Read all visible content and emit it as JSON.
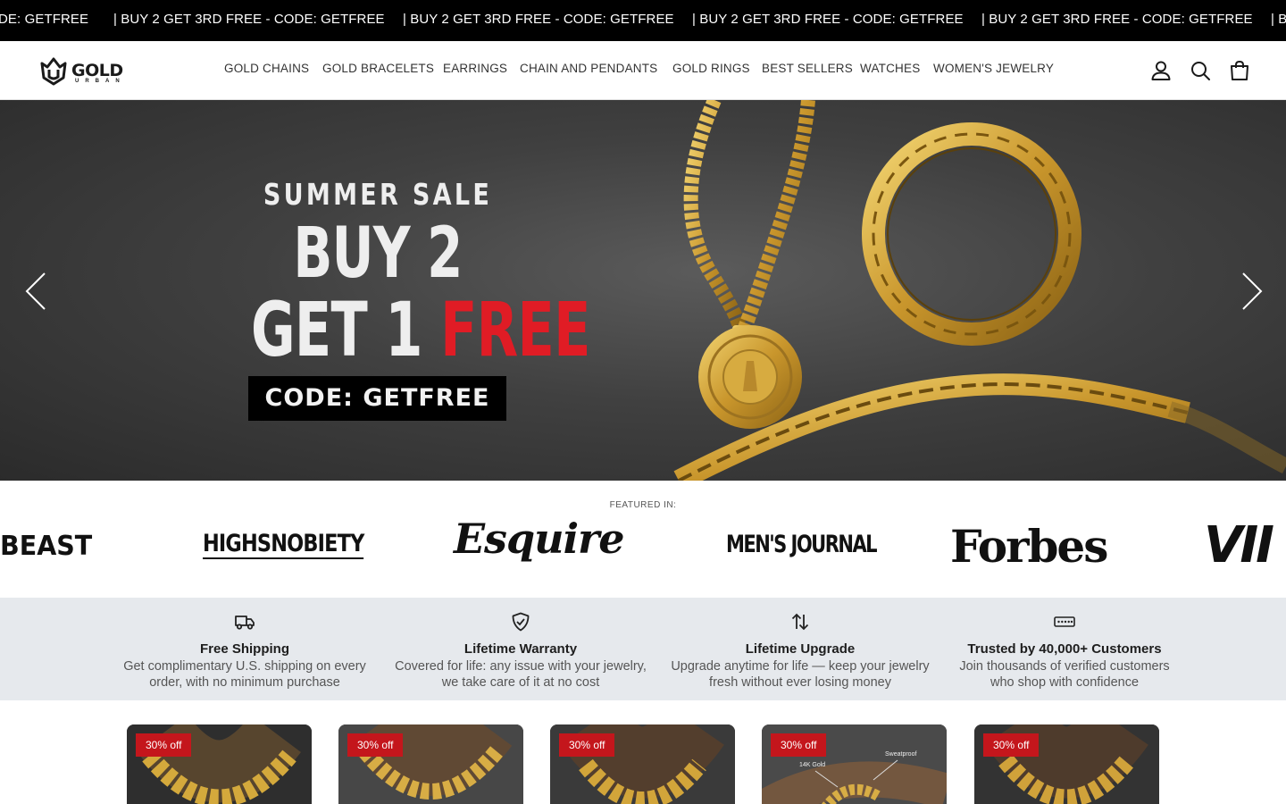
{
  "announcement": {
    "items": [
      "DE: GETFREE",
      "| BUY 2 GET 3RD FREE - CODE: GETFREE",
      "| BUY 2 GET 3RD FREE - CODE: GETFREE",
      "| BUY 2 GET 3RD FREE - CODE: GETFREE",
      "| BUY 2 GET 3RD FREE - CODE: GETFREE",
      "| B"
    ]
  },
  "header": {
    "logo_text": "GOLD",
    "logo_sub": "URBAN",
    "nav": [
      "GOLD CHAINS",
      "GOLD BRACELETS",
      "EARRINGS",
      "CHAIN AND PENDANTS",
      "GOLD RINGS",
      "BEST SELLERS",
      "WATCHES",
      "WOMEN'S JEWELRY"
    ],
    "icons": [
      "account-icon",
      "search-icon",
      "cart-icon"
    ]
  },
  "hero": {
    "small": "SUMMER SALE",
    "line1": "BUY 2",
    "line2_white": "GET 1 ",
    "line2_red": "FREE",
    "code": "CODE: GETFREE",
    "accent_color": "#e01c25"
  },
  "featured": {
    "label": "FEATURED IN:",
    "logos": [
      "BEAST",
      "HIGHSNOBIETY",
      "Esquire",
      "MEN'S JOURNAL",
      "Forbes",
      "VII"
    ]
  },
  "benefits": [
    {
      "icon": "truck-icon",
      "title": "Free Shipping",
      "desc": "Get complimentary U.S. shipping on every order, with no minimum purchase"
    },
    {
      "icon": "shield-check-icon",
      "title": "Lifetime Warranty",
      "desc": "Covered for life: any issue with your jewelry, we take care of it at no cost"
    },
    {
      "icon": "swap-arrows-icon",
      "title": "Lifetime Upgrade",
      "desc": "Upgrade anytime for life — keep your jewelry fresh without ever losing money"
    },
    {
      "icon": "stars-icon",
      "title": "Trusted by 40,000+ Customers",
      "desc": "Join thousands of verified customers who shop with confidence"
    }
  ],
  "products": [
    {
      "badge": "30% off"
    },
    {
      "badge": "30% off"
    },
    {
      "badge": "30% off"
    },
    {
      "badge": "30% off",
      "overlay_left": "14K Gold",
      "overlay_right": "Sweatproof"
    },
    {
      "badge": "30% off"
    }
  ]
}
